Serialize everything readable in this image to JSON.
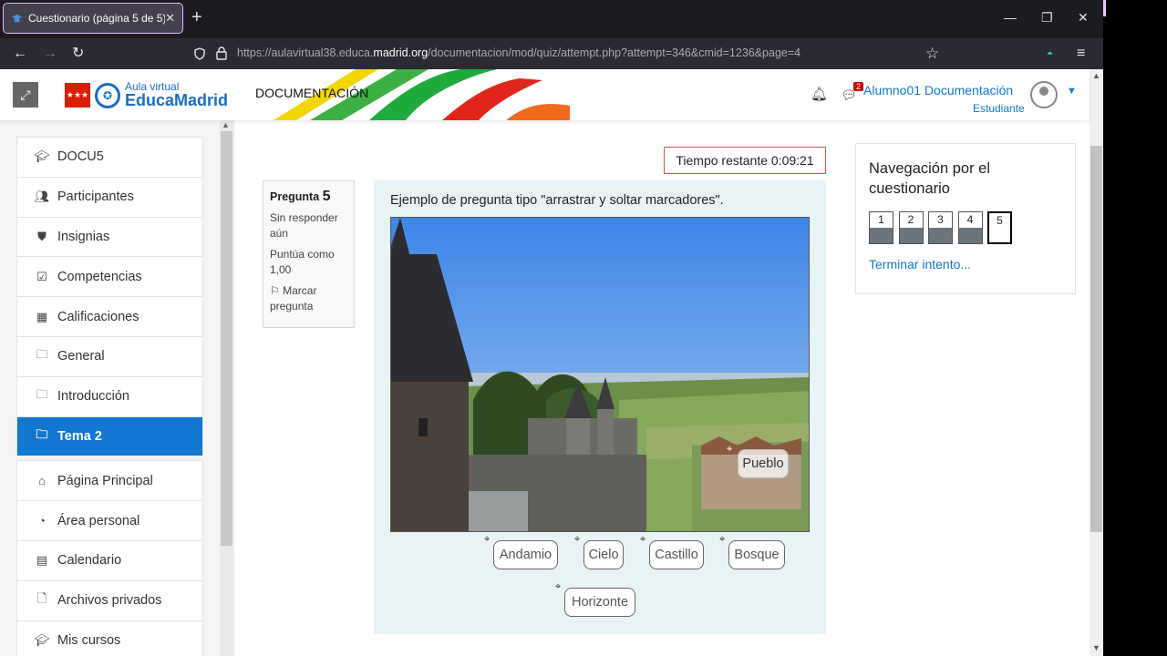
{
  "browser": {
    "tab_title": "Cuestionario (página 5 de 5)",
    "url_prefix": "https://aulavirtual38.educa.",
    "url_domain": "madrid.org",
    "url_suffix": "/documentacion/mod/quiz/attempt.php?attempt=346&cmid=1236&page=4"
  },
  "header": {
    "logo_small": "Aula virtual",
    "logo_big": "EducaMadrid",
    "course_title": "DOCUMENTACIÓN",
    "notification_count": "2",
    "user_name": "Alumno01 Documentación",
    "user_role": "Estudiante"
  },
  "drawer": {
    "items": [
      {
        "label": "DOCU5",
        "icon": "graduation-cap-icon"
      },
      {
        "label": "Participantes",
        "icon": "users-icon"
      },
      {
        "label": "Insignias",
        "icon": "shield-icon"
      },
      {
        "label": "Competencias",
        "icon": "checkbox-icon"
      },
      {
        "label": "Calificaciones",
        "icon": "table-icon"
      },
      {
        "label": "General",
        "icon": "folder-icon"
      },
      {
        "label": "Introducción",
        "icon": "folder-icon"
      },
      {
        "label": "Tema 2",
        "icon": "folder-icon"
      },
      {
        "label": "Página Principal",
        "icon": "home-icon"
      },
      {
        "label": "Área personal",
        "icon": "dashboard-icon"
      },
      {
        "label": "Calendario",
        "icon": "calendar-icon"
      },
      {
        "label": "Archivos privados",
        "icon": "file-icon"
      },
      {
        "label": "Mis cursos",
        "icon": "graduation-cap-icon"
      }
    ],
    "active_index": 7
  },
  "quiz": {
    "timer": "Tiempo restante 0:09:21",
    "question_label": "Pregunta",
    "question_number": "5",
    "status": "Sin responder aún",
    "grade": "Puntúa como 1,00",
    "flag": "Marcar pregunta",
    "question_text": "Ejemplo de pregunta tipo \"arrastrar y soltar marcadores\".",
    "placed_marker": "Pueblo",
    "markers": [
      "Andamio",
      "Cielo",
      "Castillo",
      "Bosque",
      "Horizonte"
    ]
  },
  "quiz_nav": {
    "title": "Navegación por el cuestionario",
    "buttons": [
      "1",
      "2",
      "3",
      "4",
      "5"
    ],
    "answered": [
      true,
      true,
      true,
      true,
      false
    ],
    "current": "5",
    "finish_link": "Terminar intento..."
  },
  "colors": {
    "primary": "#1177d1",
    "active_menu": "#1177d1",
    "question_bg": "#e7f3f5",
    "timer_border": "#d9534f"
  }
}
